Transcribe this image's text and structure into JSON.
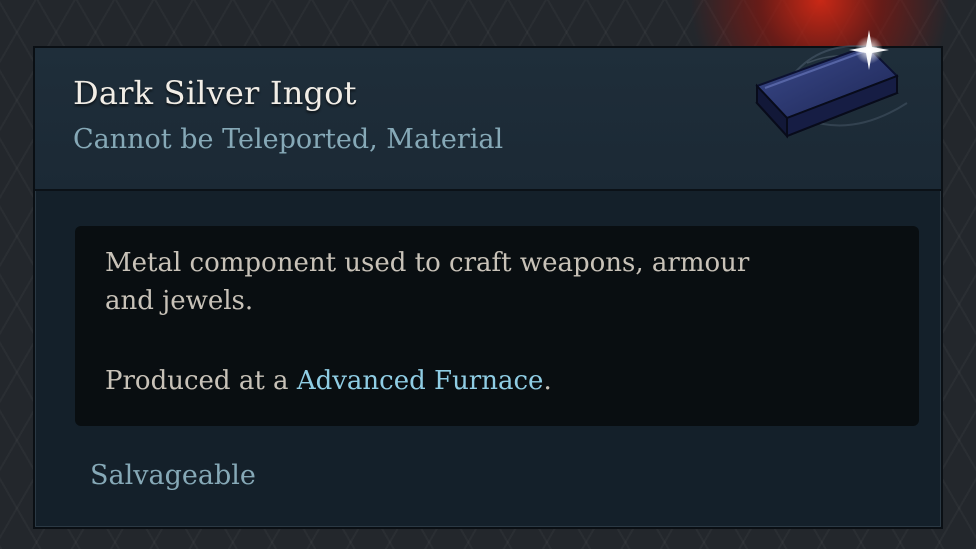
{
  "item": {
    "name": "Dark Silver Ingot",
    "tags": "Cannot be Teleported, Material",
    "icon": "dark-silver-ingot-icon"
  },
  "description": {
    "line1": "Metal component used to craft weapons, armour",
    "line2": "and jewels.",
    "produced_prefix": "Produced at a ",
    "produced_place": "Advanced Furnace",
    "produced_suffix": "."
  },
  "footer": {
    "salvage": "Salvageable"
  },
  "colors": {
    "name": "#f1ede6",
    "tags": "#86a9b7",
    "highlight": "#8fcde4",
    "panel": "#14202a",
    "header": "#1f2e3a",
    "desc_box": "#090e11"
  }
}
